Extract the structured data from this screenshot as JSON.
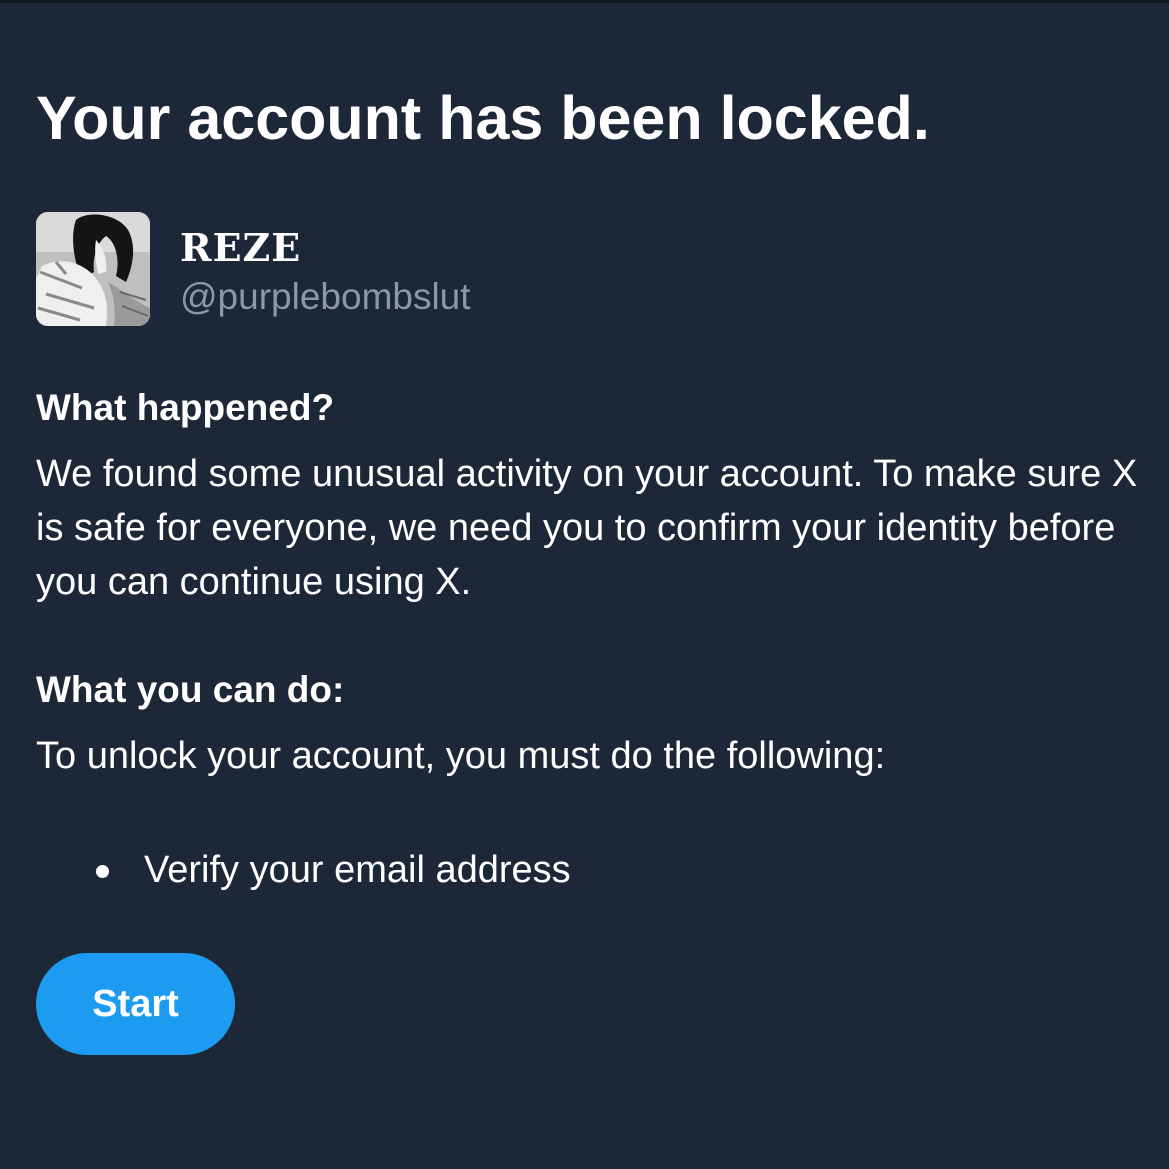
{
  "theme": {
    "background": "#1c2837",
    "text": "#ffffff",
    "muted_text": "#8b98a5",
    "accent": "#1d9bf0"
  },
  "title": "Your account has been locked.",
  "account": {
    "display_name": "REZE",
    "handle": "@purplebombslut",
    "avatar_icon": "profile-avatar-image"
  },
  "what_happened": {
    "heading": "What happened?",
    "body": "We found some unusual activity on your account. To make sure X is safe for everyone, we need you to confirm your identity before you can continue using X."
  },
  "what_you_can_do": {
    "heading": "What you can do:",
    "body": "To unlock your account, you must do the following:",
    "steps": [
      "Verify your email address"
    ]
  },
  "actions": {
    "start_label": "Start"
  }
}
